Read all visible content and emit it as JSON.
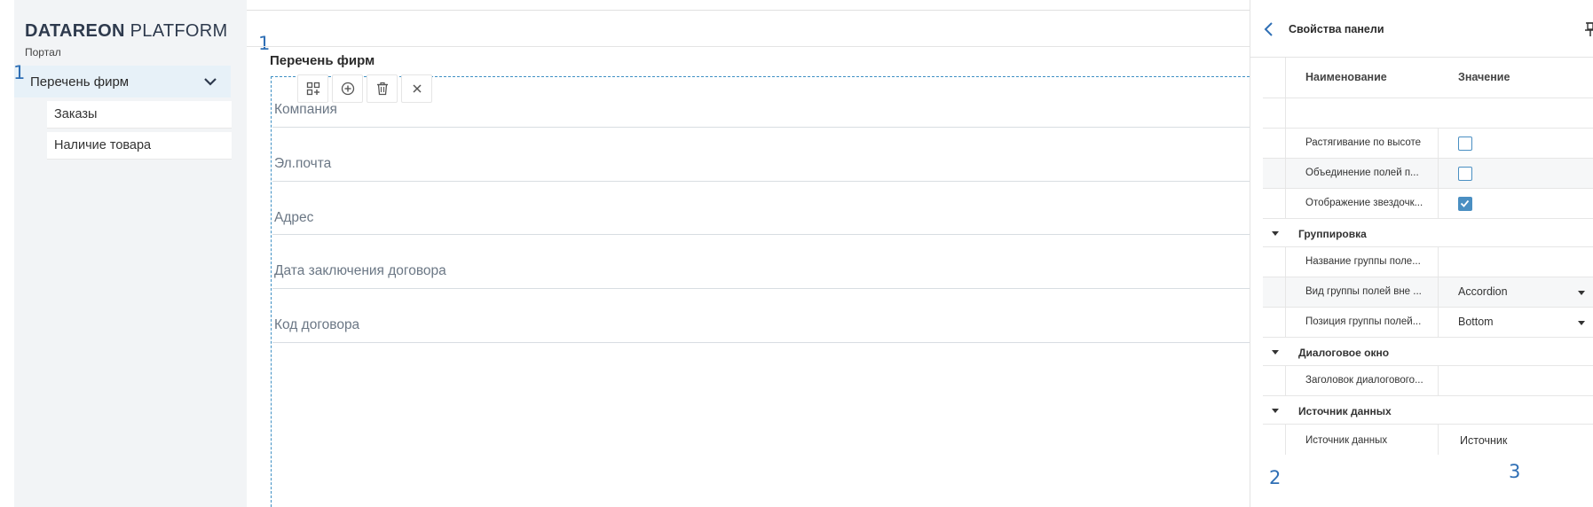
{
  "brand": {
    "bold": "DATAREON",
    "light": "PLATFORM",
    "subtitle": "Портал"
  },
  "sidebar": {
    "group_label": "Перечень фирм",
    "items": [
      {
        "label": "Заказы"
      },
      {
        "label": "Наличие товара"
      }
    ]
  },
  "markers": {
    "nav": "1",
    "canvas": "1",
    "grid": "2",
    "value": "3"
  },
  "content": {
    "title": "Перечень фирм",
    "fields": [
      {
        "label": "Компания"
      },
      {
        "label": "Эл.почта"
      },
      {
        "label": "Адрес"
      },
      {
        "label": "Дата заключения договора"
      },
      {
        "label": "Код договора"
      }
    ],
    "toolbar": [
      {
        "icon": "grid-add-icon"
      },
      {
        "icon": "plus-circle-icon"
      },
      {
        "icon": "trash-icon"
      },
      {
        "icon": "close-icon"
      }
    ]
  },
  "panel": {
    "title": "Свойства панели",
    "col_name": "Наименование",
    "col_value": "Значение",
    "props": {
      "stretch": {
        "name": "Растягивание по высоте",
        "checked": false
      },
      "merge": {
        "name": "Объединение полей п...",
        "checked": false
      },
      "asterisk": {
        "name": "Отображение звездочк...",
        "checked": true
      }
    },
    "sections": {
      "grouping": "Группировка",
      "dialog": "Диалоговое окно",
      "datasource": "Источник данных"
    },
    "group_props": {
      "group_name": {
        "name": "Название группы поле..."
      },
      "group_view": {
        "name": "Вид группы полей вне ...",
        "value": "Accordion"
      },
      "group_pos": {
        "name": "Позиция группы полей...",
        "value": "Bottom"
      }
    },
    "dialog_props": {
      "header": {
        "name": "Заголовок диалогового..."
      }
    },
    "ds_props": {
      "source": {
        "name": "Источник данных",
        "value": "Источник"
      }
    }
  },
  "colors": {
    "accent": "#3f90c4",
    "nav_active": "#e7f1f8",
    "sidebar_bg": "#f2f4f6"
  }
}
